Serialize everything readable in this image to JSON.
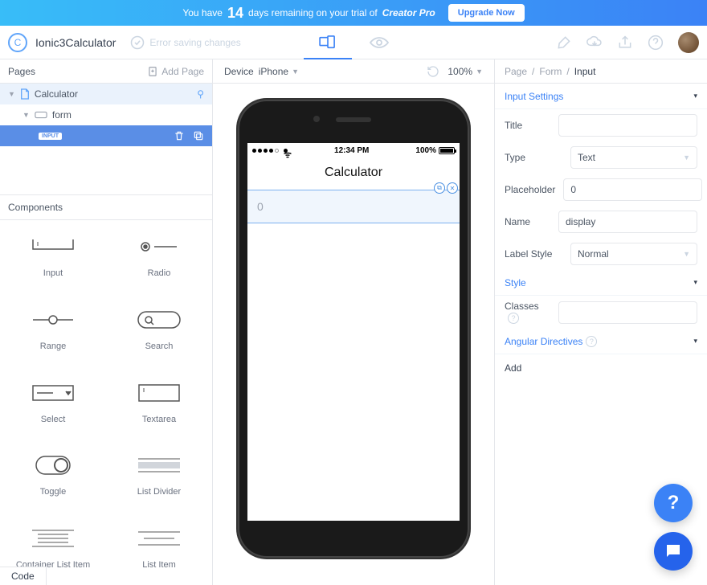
{
  "banner": {
    "prefix": "You have",
    "days": "14",
    "middle": "days remaining on your trial of",
    "product": "Creator Pro",
    "cta": "Upgrade Now"
  },
  "toolbar": {
    "app_name": "Ionic3Calculator",
    "save_status": "Error saving changes"
  },
  "pages": {
    "header": "Pages",
    "add_label": "Add Page",
    "tree": {
      "root": "Calculator",
      "child": "form",
      "selected_badge": "INPUT"
    }
  },
  "components": {
    "header": "Components",
    "items": [
      {
        "label": "Input"
      },
      {
        "label": "Radio"
      },
      {
        "label": "Range"
      },
      {
        "label": "Search"
      },
      {
        "label": "Select"
      },
      {
        "label": "Textarea"
      },
      {
        "label": "Toggle"
      },
      {
        "label": "List Divider"
      },
      {
        "label": "Container List Item"
      },
      {
        "label": "List Item"
      }
    ]
  },
  "canvas": {
    "device_label": "Device",
    "device_value": "iPhone",
    "zoom": "100%",
    "phone": {
      "time": "12:34 PM",
      "battery": "100%",
      "title": "Calculator",
      "display_placeholder": "0"
    }
  },
  "inspector": {
    "breadcrumb": {
      "a": "Page",
      "b": "Form",
      "c": "Input"
    },
    "sections": {
      "settings_title": "Input Settings",
      "style_title": "Style",
      "directives_title": "Angular Directives"
    },
    "fields": {
      "title_label": "Title",
      "title_value": "",
      "type_label": "Type",
      "type_value": "Text",
      "placeholder_label": "Placeholder",
      "placeholder_value": "0",
      "name_label": "Name",
      "name_value": "display",
      "labelstyle_label": "Label Style",
      "labelstyle_value": "Normal",
      "classes_label": "Classes",
      "classes_value": ""
    },
    "add_directive": "Add"
  },
  "code_tab": "Code"
}
